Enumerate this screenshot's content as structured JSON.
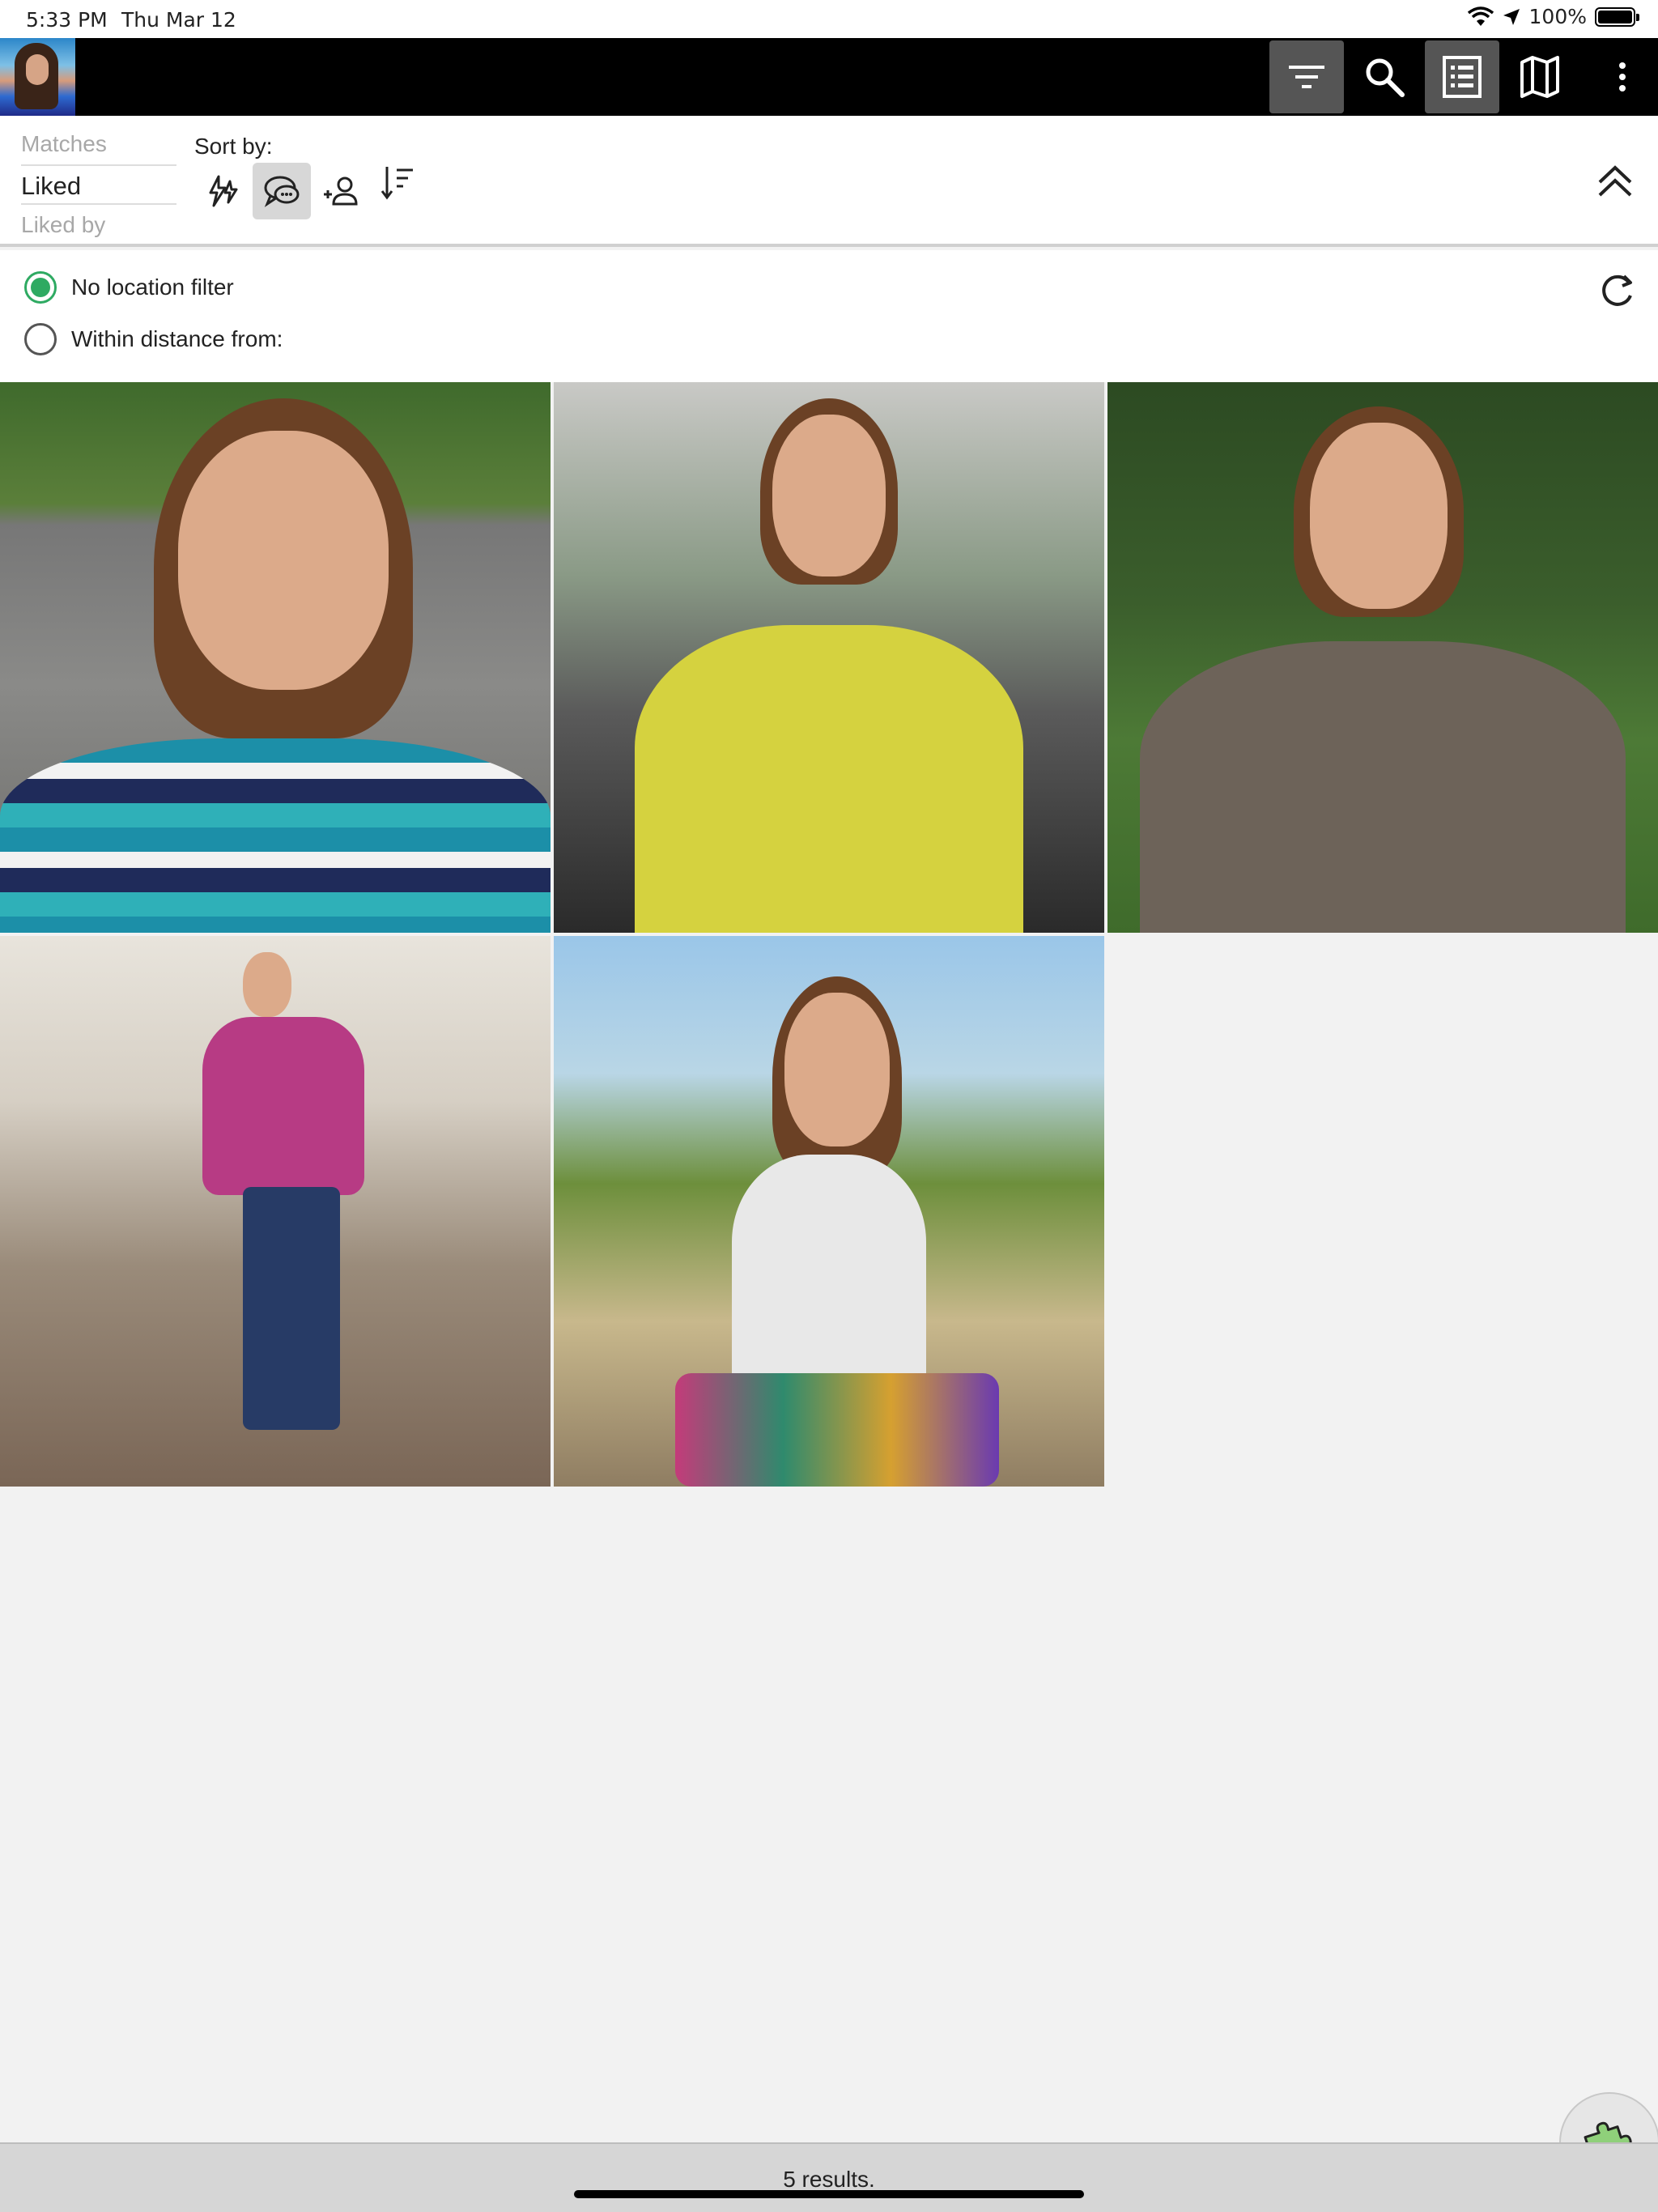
{
  "status_bar": {
    "time": "5:33 PM",
    "date": "Thu Mar 12",
    "battery": "100%"
  },
  "toolbar": {
    "buttons": [
      {
        "icon": "filter-icon",
        "active": true
      },
      {
        "icon": "search-icon",
        "active": false
      },
      {
        "icon": "list-view-icon",
        "active": true
      },
      {
        "icon": "map-icon",
        "active": false
      },
      {
        "icon": "more-vert-icon",
        "active": false
      }
    ]
  },
  "list_picker": {
    "options": [
      "Matches",
      "Liked",
      "Liked by"
    ],
    "selected": "Liked"
  },
  "sort": {
    "label": "Sort by:",
    "options": [
      {
        "icon": "activity-icon",
        "active": false
      },
      {
        "icon": "chat-icon",
        "active": true
      },
      {
        "icon": "add-person-icon",
        "active": false
      },
      {
        "icon": "sort-order-icon",
        "active": false
      }
    ]
  },
  "location": {
    "option_none": "No location filter",
    "option_distance": "Within distance from:",
    "selected": "No location filter"
  },
  "results": {
    "text": "5 results."
  },
  "colors": {
    "toolbar_bg": "#000000",
    "accent_green": "#2eaa62",
    "active_button": "#555555"
  }
}
